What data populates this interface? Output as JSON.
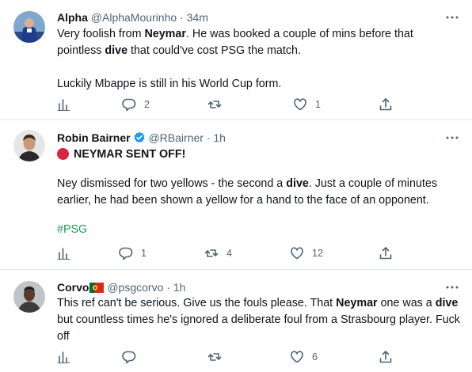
{
  "tweets": [
    {
      "name": "Alpha",
      "handle": "@AlphaMourinho",
      "sep": "·",
      "time": "34m",
      "text_parts": [
        "Very foolish from ",
        "Neymar",
        ". He was booked a couple of mins before that pointless ",
        "dive",
        " that could've cost PSG the match."
      ],
      "text2": "Luckily Mbappe is still in his World Cup form.",
      "stats": {
        "replies": "2",
        "retweets": "",
        "likes": "1"
      }
    },
    {
      "name": "Robin Bairner",
      "handle": "@RBairner",
      "sep": "·",
      "time": "1h",
      "headline": "NEYMAR SENT OFF!",
      "text_parts": [
        "Ney dismissed for two yellows - the second a ",
        "dive",
        ". Just a couple of minutes earlier, he had been shown a yellow for a hand to the face of an opponent."
      ],
      "hashtag": "#PSG",
      "stats": {
        "replies": "1",
        "retweets": "4",
        "likes": "12"
      }
    },
    {
      "name": "Corvo",
      "handle": "@psgcorvo",
      "sep": "·",
      "time": "1h",
      "text_parts": [
        "This ref can't be serious. Give us the fouls please. That ",
        "Neymar",
        " one was a ",
        "dive",
        " but countless times he's ignored a deliberate foul from a Strasbourg player. Fuck off"
      ],
      "stats": {
        "replies": "",
        "retweets": "",
        "likes": "6"
      }
    }
  ],
  "icons": {
    "more": "more-horizontal-icon",
    "analytics": "analytics-icon",
    "reply": "reply-icon",
    "retweet": "retweet-icon",
    "like": "heart-icon",
    "share": "share-icon",
    "verified": "verified-badge-icon",
    "flag": "portugal-flag-icon"
  },
  "colors": {
    "hashtag": "#1d9b50",
    "verified": "#1d9bf0",
    "red_dot": "#d7263d",
    "muted": "#536471"
  }
}
